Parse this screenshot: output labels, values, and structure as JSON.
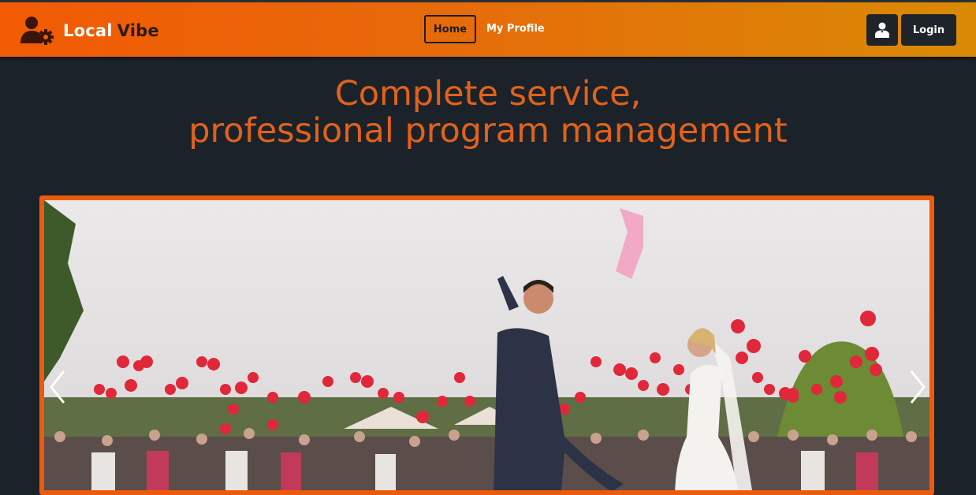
{
  "brand": {
    "name_part1": "Local",
    "name_part2": "Vibe",
    "icon": "user-gear-icon"
  },
  "nav": {
    "home_label": "Home",
    "profile_label": "My Profile"
  },
  "actions": {
    "user_icon": "user-icon",
    "login_label": "Login"
  },
  "hero": {
    "title_line1": "Complete service,",
    "title_line2": "professional program management"
  },
  "carousel": {
    "slide_alt": "Wedding couple releasing red balloons with guests",
    "prev_icon": "chevron-left-icon",
    "next_icon": "chevron-right-icon"
  },
  "colors": {
    "accent": "#ee5a0c",
    "background": "#1c2229",
    "title": "#e0621b"
  }
}
